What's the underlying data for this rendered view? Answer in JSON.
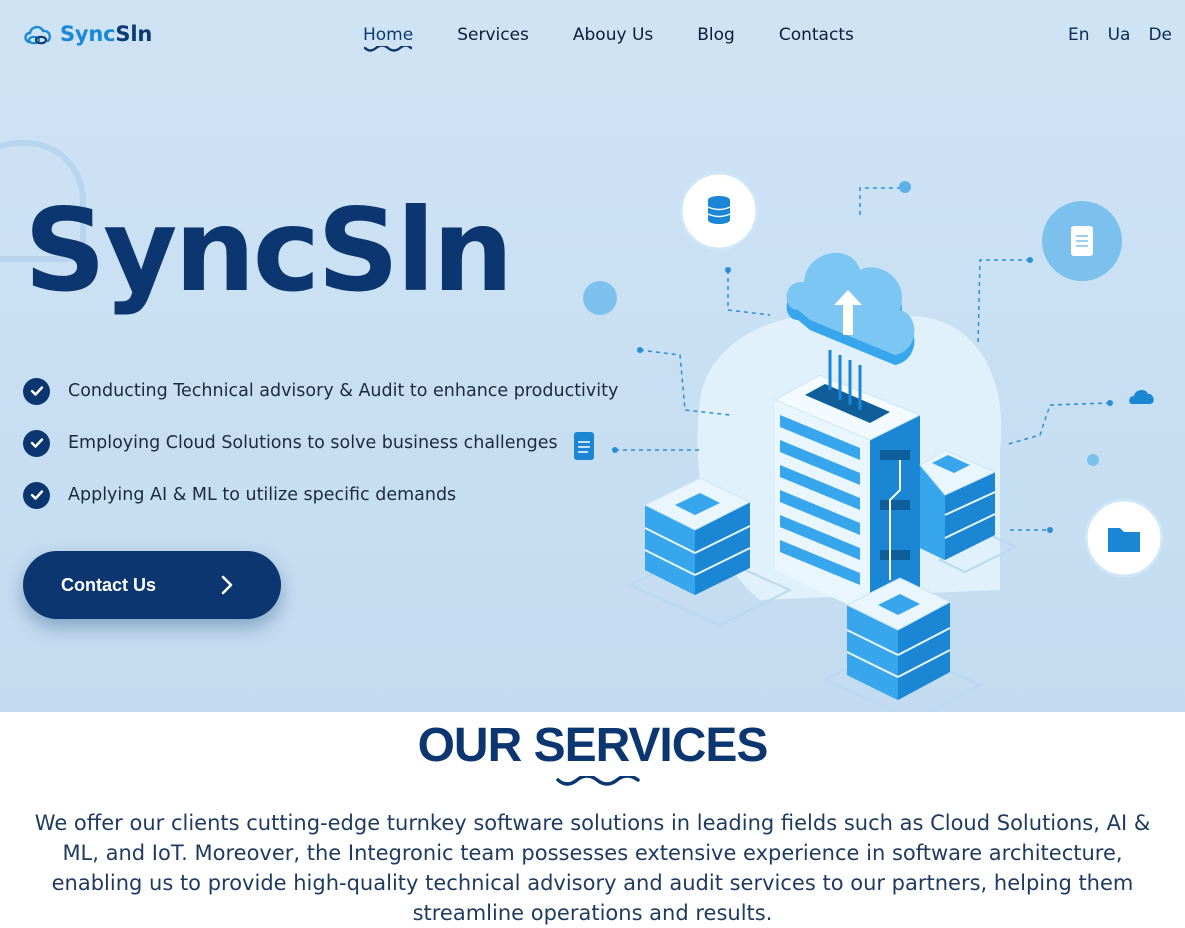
{
  "header": {
    "logo_part1": "Sync",
    "logo_part2": "Sln",
    "nav": [
      "Home",
      "Services",
      "Abouy Us",
      "Blog",
      "Contacts"
    ],
    "active_nav": "Home",
    "languages": [
      "En",
      "Ua",
      "De"
    ]
  },
  "hero": {
    "title": "SyncSln",
    "features": [
      "Conducting Technical advisory & Audit to enhance productivity",
      "Employing Cloud Solutions to solve business challenges",
      "Applying AI & ML to utilize specific demands"
    ],
    "cta_label": "Contact Us"
  },
  "services": {
    "title": "OUR SERVICES",
    "text": "We offer our clients cutting-edge turnkey software solutions in leading fields such as Cloud Solutions, AI & ML, and IoT. Moreover, the Integronic team possesses extensive experience in software architecture, enabling us to provide high-quality technical advisory and audit services to our partners, helping them streamline operations and results."
  },
  "colors": {
    "primary": "#0c3670",
    "accent": "#1b88d6",
    "hero_bg": "#cfe3f4"
  },
  "icons": [
    "cloud-link-logo-icon",
    "check-icon",
    "chevron-right-icon",
    "database-icon",
    "document-icon",
    "cloud-icon",
    "folder-icon",
    "server-cloud-illustration"
  ]
}
